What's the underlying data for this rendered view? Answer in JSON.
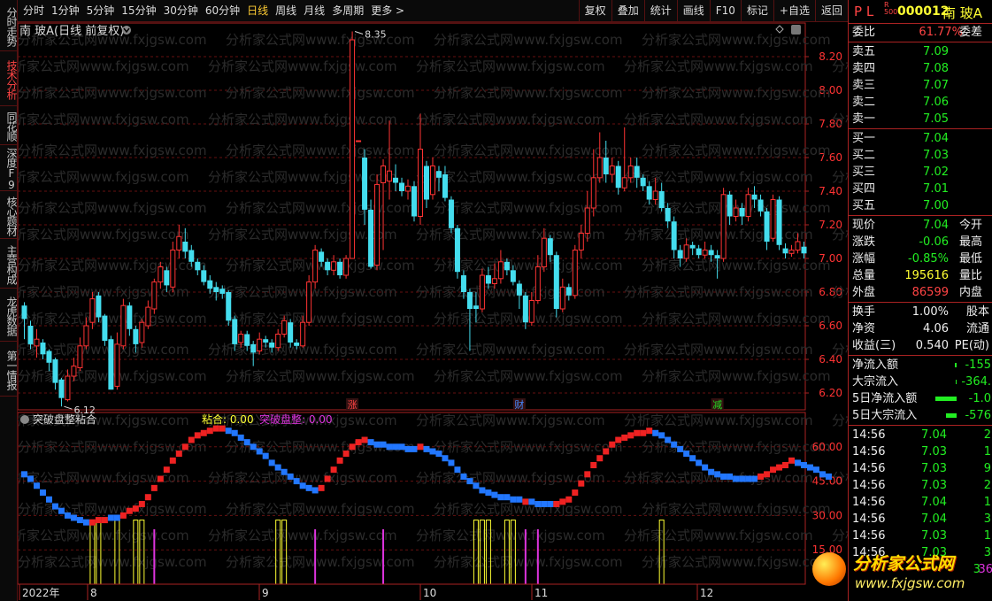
{
  "toolbar": {
    "periods": [
      "分时",
      "1分钟",
      "5分钟",
      "15分钟",
      "30分钟",
      "60分钟",
      "日线",
      "周线",
      "月线",
      "多周期",
      "更多 >"
    ],
    "active_period": "日线",
    "right_buttons": [
      "复权",
      "叠加",
      "统计",
      "画线",
      "F10",
      "标记",
      "+自选",
      "返回"
    ]
  },
  "left_nav": [
    "分时走势",
    "技术分析",
    "同花顺",
    "深度F9",
    "核心题材",
    "主营构成",
    "龙虎数据",
    "第一情报"
  ],
  "left_nav_active": 1,
  "main_chart": {
    "title": "南 玻A(日线 前复权)",
    "high_label": "8.35",
    "low_label": "6.12",
    "y_ticks": [
      "8.20",
      "8.00",
      "7.80",
      "7.60",
      "7.40",
      "7.20",
      "7.00",
      "6.80",
      "6.60",
      "6.40",
      "6.20"
    ],
    "markers": [
      "涨",
      "财",
      "减"
    ]
  },
  "indicator": {
    "name": "突破盘整粘合",
    "label1": "粘合: 0.00",
    "label2": "突破盘整: 0.00",
    "y_ticks": [
      "60.00",
      "45.00",
      "30.00",
      "15.00"
    ]
  },
  "x_axis": [
    "2022年",
    "8",
    "9",
    "10",
    "11",
    "12"
  ],
  "watermark": "分析家公式网www.fxjgsw.com",
  "logo_text": "分析家公式网",
  "logo_url": "www.fxjgsw.com",
  "colors": {
    "up": "#ff3333",
    "down": "#44ddee",
    "grid": "#661111",
    "border": "#aa2222",
    "yellow": "#ffff33",
    "magenta": "#dd33dd",
    "accent": "#ffcc33"
  },
  "chart_data": {
    "type": "candlestick",
    "series": "南玻A 日线",
    "candles": [
      [
        6.72,
        6.64,
        6.74,
        6.52
      ],
      [
        6.6,
        6.49,
        6.63,
        6.46
      ],
      [
        6.48,
        6.52,
        6.58,
        6.41
      ],
      [
        6.5,
        6.43,
        6.52,
        6.4
      ],
      [
        6.45,
        6.38,
        6.46,
        6.33
      ],
      [
        6.4,
        6.26,
        6.41,
        6.22
      ],
      [
        6.28,
        6.17,
        6.29,
        6.12
      ],
      [
        6.16,
        6.3,
        6.34,
        6.15
      ],
      [
        6.3,
        6.36,
        6.41,
        6.27
      ],
      [
        6.35,
        6.48,
        6.53,
        6.33
      ],
      [
        6.48,
        6.6,
        6.65,
        6.46
      ],
      [
        6.62,
        6.76,
        6.8,
        6.58
      ],
      [
        6.78,
        6.65,
        6.8,
        6.62
      ],
      [
        6.66,
        6.51,
        6.67,
        6.48
      ],
      [
        6.52,
        6.22,
        6.54,
        6.22
      ],
      [
        6.24,
        6.49,
        6.56,
        6.22
      ],
      [
        6.48,
        6.72,
        6.76,
        6.46
      ],
      [
        6.72,
        6.58,
        6.74,
        6.54
      ],
      [
        6.58,
        6.49,
        6.6,
        6.44
      ],
      [
        6.5,
        6.62,
        6.64,
        6.47
      ],
      [
        6.6,
        6.71,
        6.75,
        6.58
      ],
      [
        6.7,
        6.86,
        6.88,
        6.67
      ],
      [
        6.86,
        6.95,
        6.98,
        6.82
      ],
      [
        6.93,
        6.84,
        6.95,
        6.8
      ],
      [
        6.83,
        7.05,
        7.1,
        6.8
      ],
      [
        7.05,
        7.13,
        7.2,
        7.0
      ],
      [
        7.1,
        7.04,
        7.18,
        7.0
      ],
      [
        7.05,
        6.98,
        7.08,
        6.95
      ],
      [
        6.98,
        6.93,
        7.0,
        6.9
      ],
      [
        6.93,
        6.86,
        6.96,
        6.84
      ],
      [
        6.87,
        6.82,
        6.9,
        6.79
      ],
      [
        6.83,
        6.8,
        6.86,
        6.75
      ],
      [
        6.82,
        6.79,
        6.84,
        6.76
      ],
      [
        6.8,
        6.63,
        6.81,
        6.6
      ],
      [
        6.64,
        6.49,
        6.66,
        6.45
      ],
      [
        6.5,
        6.55,
        6.57,
        6.47
      ],
      [
        6.55,
        6.48,
        6.57,
        6.45
      ],
      [
        6.49,
        6.44,
        6.51,
        6.36
      ],
      [
        6.45,
        6.52,
        6.56,
        6.43
      ],
      [
        6.52,
        6.5,
        6.54,
        6.47
      ],
      [
        6.5,
        6.47,
        6.52,
        6.44
      ],
      [
        6.47,
        6.55,
        6.58,
        6.45
      ],
      [
        6.55,
        6.63,
        6.66,
        6.53
      ],
      [
        6.62,
        6.5,
        6.64,
        6.47
      ],
      [
        6.5,
        6.48,
        6.52,
        6.46
      ],
      [
        6.48,
        6.62,
        6.66,
        6.47
      ],
      [
        6.62,
        6.86,
        6.9,
        6.6
      ],
      [
        6.86,
        7.05,
        7.08,
        6.82
      ],
      [
        7.04,
        6.98,
        7.06,
        6.95
      ],
      [
        6.98,
        6.93,
        7.0,
        6.9
      ],
      [
        6.93,
        6.98,
        7.02,
        6.9
      ],
      [
        6.98,
        6.9,
        7.0,
        6.88
      ],
      [
        6.9,
        7.0,
        7.02,
        6.88
      ],
      [
        7.0,
        8.3,
        8.35,
        7.0
      ],
      [
        7.7,
        7.7,
        7.7,
        7.7
      ],
      [
        7.6,
        7.29,
        7.65,
        7.2
      ],
      [
        7.29,
        6.95,
        7.35,
        6.94
      ],
      [
        6.96,
        7.44,
        7.5,
        6.93
      ],
      [
        7.45,
        7.55,
        7.59,
        7.05
      ],
      [
        7.46,
        7.52,
        7.82,
        7.35
      ],
      [
        7.48,
        7.45,
        7.56,
        7.4
      ],
      [
        7.45,
        7.4,
        7.48,
        7.37
      ],
      [
        7.4,
        7.43,
        7.47,
        7.35
      ],
      [
        7.43,
        7.25,
        7.46,
        7.22
      ],
      [
        7.25,
        7.65,
        7.86,
        7.2
      ],
      [
        7.55,
        7.35,
        7.58,
        7.3
      ],
      [
        7.38,
        7.55,
        7.6,
        7.35
      ],
      [
        7.52,
        7.48,
        7.55,
        7.4
      ],
      [
        7.5,
        7.36,
        7.55,
        7.34
      ],
      [
        7.35,
        7.18,
        7.37,
        7.15
      ],
      [
        7.18,
        6.92,
        7.2,
        6.88
      ],
      [
        6.9,
        6.8,
        6.93,
        6.76
      ],
      [
        6.8,
        6.7,
        6.82,
        6.45
      ],
      [
        6.72,
        6.7,
        6.8,
        6.62
      ],
      [
        6.7,
        6.9,
        6.94,
        6.68
      ],
      [
        6.9,
        6.85,
        6.95,
        6.82
      ],
      [
        6.85,
        6.88,
        6.97,
        6.82
      ],
      [
        6.88,
        6.98,
        7.05,
        6.85
      ],
      [
        6.98,
        6.93,
        7.0,
        6.9
      ],
      [
        6.93,
        6.86,
        6.96,
        6.84
      ],
      [
        6.85,
        6.78,
        6.87,
        6.7
      ],
      [
        6.78,
        6.62,
        6.8,
        6.58
      ],
      [
        6.62,
        6.75,
        6.8,
        6.6
      ],
      [
        6.75,
        6.95,
        7.02,
        6.73
      ],
      [
        6.95,
        7.12,
        7.18,
        6.92
      ],
      [
        7.12,
        7.02,
        7.14,
        6.98
      ],
      [
        7.02,
        6.7,
        7.04,
        6.65
      ],
      [
        6.7,
        6.83,
        6.88,
        6.68
      ],
      [
        6.83,
        6.78,
        6.85,
        6.75
      ],
      [
        6.78,
        7.05,
        7.08,
        6.76
      ],
      [
        7.05,
        7.15,
        7.2,
        7.0
      ],
      [
        7.15,
        7.3,
        7.4,
        7.1
      ],
      [
        7.3,
        7.48,
        7.65,
        7.25
      ],
      [
        7.48,
        7.6,
        7.75,
        7.45
      ],
      [
        7.6,
        7.5,
        7.7,
        7.45
      ],
      [
        7.5,
        7.55,
        7.6,
        7.45
      ],
      [
        7.55,
        7.42,
        7.58,
        7.38
      ],
      [
        7.42,
        7.48,
        7.78,
        7.4
      ],
      [
        7.48,
        7.55,
        7.6,
        7.45
      ],
      [
        7.55,
        7.48,
        7.6,
        7.42
      ],
      [
        7.48,
        7.43,
        7.5,
        7.4
      ],
      [
        7.43,
        7.35,
        7.46,
        7.32
      ],
      [
        7.35,
        7.4,
        7.48,
        7.32
      ],
      [
        7.4,
        7.3,
        7.45,
        7.28
      ],
      [
        7.3,
        7.22,
        7.33,
        7.18
      ],
      [
        7.22,
        7.05,
        7.25,
        7.0
      ],
      [
        7.05,
        7.0,
        7.08,
        6.95
      ],
      [
        7.0,
        7.08,
        7.12,
        6.98
      ],
      [
        7.08,
        7.06,
        7.1,
        7.02
      ],
      [
        7.06,
        7.02,
        7.08,
        7.0
      ],
      [
        7.02,
        7.05,
        7.1,
        7.0
      ],
      [
        7.05,
        7.02,
        7.08,
        6.98
      ],
      [
        7.02,
        7.0,
        7.05,
        6.88
      ],
      [
        7.0,
        7.38,
        7.42,
        6.98
      ],
      [
        7.38,
        7.25,
        7.4,
        7.2
      ],
      [
        7.25,
        7.3,
        7.35,
        7.22
      ],
      [
        7.3,
        7.25,
        7.33,
        7.2
      ],
      [
        7.25,
        7.38,
        7.42,
        7.22
      ],
      [
        7.38,
        7.35,
        7.43,
        7.3
      ],
      [
        7.35,
        7.28,
        7.38,
        7.25
      ],
      [
        7.28,
        7.1,
        7.3,
        7.05
      ],
      [
        7.12,
        7.35,
        7.38,
        7.1
      ],
      [
        7.35,
        7.08,
        7.37,
        7.05
      ],
      [
        7.06,
        7.03,
        7.09,
        7.0
      ],
      [
        7.03,
        7.05,
        7.08,
        7.01
      ],
      [
        7.05,
        7.1,
        7.15,
        7.03
      ],
      [
        7.07,
        7.03,
        7.1,
        7.0
      ]
    ],
    "y_range": [
      6.1,
      8.4
    ]
  },
  "indicator_data": {
    "type": "bar",
    "dots": [
      [
        48,
        0
      ],
      [
        46,
        0
      ],
      [
        43,
        0
      ],
      [
        40,
        0
      ],
      [
        37,
        0
      ],
      [
        34,
        0
      ],
      [
        32,
        0
      ],
      [
        30,
        0
      ],
      [
        29,
        0
      ],
      [
        28,
        0
      ],
      [
        27,
        0
      ],
      [
        27,
        1
      ],
      [
        28,
        1
      ],
      [
        28,
        1
      ],
      [
        29,
        0
      ],
      [
        29,
        0
      ],
      [
        30,
        1
      ],
      [
        32,
        1
      ],
      [
        33,
        1
      ],
      [
        35,
        1
      ],
      [
        38,
        1
      ],
      [
        42,
        1
      ],
      [
        46,
        1
      ],
      [
        50,
        1
      ],
      [
        54,
        1
      ],
      [
        57,
        1
      ],
      [
        60,
        1
      ],
      [
        63,
        1
      ],
      [
        65,
        1
      ],
      [
        66,
        1
      ],
      [
        67,
        1
      ],
      [
        68,
        1
      ],
      [
        68,
        1
      ],
      [
        67,
        0
      ],
      [
        66,
        0
      ],
      [
        64,
        0
      ],
      [
        62,
        0
      ],
      [
        60,
        0
      ],
      [
        58,
        0
      ],
      [
        56,
        0
      ],
      [
        53,
        0
      ],
      [
        51,
        0
      ],
      [
        49,
        0
      ],
      [
        47,
        0
      ],
      [
        45,
        0
      ],
      [
        43,
        0
      ],
      [
        42,
        0
      ],
      [
        41,
        0
      ],
      [
        42,
        1
      ],
      [
        46,
        1
      ],
      [
        50,
        1
      ],
      [
        54,
        1
      ],
      [
        57,
        1
      ],
      [
        60,
        1
      ],
      [
        62,
        1
      ],
      [
        63,
        1
      ],
      [
        62,
        0
      ],
      [
        61,
        0
      ],
      [
        61,
        0
      ],
      [
        60,
        0
      ],
      [
        60,
        0
      ],
      [
        60,
        0
      ],
      [
        59,
        0
      ],
      [
        59,
        0
      ],
      [
        60,
        1
      ],
      [
        59,
        0
      ],
      [
        58,
        0
      ],
      [
        57,
        0
      ],
      [
        55,
        0
      ],
      [
        53,
        0
      ],
      [
        50,
        0
      ],
      [
        47,
        0
      ],
      [
        45,
        0
      ],
      [
        43,
        0
      ],
      [
        41,
        0
      ],
      [
        40,
        0
      ],
      [
        39,
        0
      ],
      [
        38,
        0
      ],
      [
        38,
        0
      ],
      [
        37,
        0
      ],
      [
        37,
        0
      ],
      [
        36,
        1
      ],
      [
        36,
        0
      ],
      [
        35,
        0
      ],
      [
        35,
        0
      ],
      [
        35,
        0
      ],
      [
        35,
        1
      ],
      [
        36,
        1
      ],
      [
        37,
        1
      ],
      [
        40,
        1
      ],
      [
        44,
        1
      ],
      [
        48,
        1
      ],
      [
        52,
        1
      ],
      [
        55,
        1
      ],
      [
        58,
        1
      ],
      [
        61,
        1
      ],
      [
        63,
        1
      ],
      [
        64,
        1
      ],
      [
        65,
        1
      ],
      [
        66,
        1
      ],
      [
        66,
        1
      ],
      [
        67,
        1
      ],
      [
        66,
        0
      ],
      [
        65,
        0
      ],
      [
        63,
        0
      ],
      [
        61,
        0
      ],
      [
        59,
        0
      ],
      [
        57,
        0
      ],
      [
        55,
        0
      ],
      [
        53,
        0
      ],
      [
        51,
        0
      ],
      [
        49,
        0
      ],
      [
        48,
        0
      ],
      [
        47,
        0
      ],
      [
        47,
        0
      ],
      [
        46,
        0
      ],
      [
        46,
        0
      ],
      [
        46,
        0
      ],
      [
        46,
        0
      ],
      [
        47,
        1
      ],
      [
        48,
        1
      ],
      [
        50,
        1
      ],
      [
        51,
        1
      ],
      [
        52,
        1
      ],
      [
        54,
        1
      ],
      [
        53,
        0
      ],
      [
        52,
        0
      ],
      [
        51,
        0
      ],
      [
        50,
        0
      ],
      [
        48,
        0
      ],
      [
        47,
        0
      ]
    ],
    "yellow_bars": [
      11,
      12,
      15,
      18,
      19,
      41,
      42,
      73,
      74,
      75,
      78,
      79,
      103
    ],
    "magenta_bars": [
      21,
      47,
      58,
      81,
      83
    ],
    "y_range": [
      0,
      75
    ]
  },
  "quote": {
    "header": {
      "pl": "P L",
      "r_sub": "R\n500",
      "code": "000012",
      "name": "南 玻A"
    },
    "weibi": {
      "label": "委比",
      "value": "61.77%",
      "label2": "委差"
    },
    "asks": [
      {
        "label": "卖五",
        "price": "7.09"
      },
      {
        "label": "卖四",
        "price": "7.08"
      },
      {
        "label": "卖三",
        "price": "7.07"
      },
      {
        "label": "卖二",
        "price": "7.06"
      },
      {
        "label": "卖一",
        "price": "7.05"
      }
    ],
    "bids": [
      {
        "label": "买一",
        "price": "7.04"
      },
      {
        "label": "买二",
        "price": "7.03"
      },
      {
        "label": "买三",
        "price": "7.02"
      },
      {
        "label": "买四",
        "price": "7.01"
      },
      {
        "label": "买五",
        "price": "7.00"
      }
    ],
    "stats": [
      {
        "label": "现价",
        "value": "7.04",
        "label2": "今开",
        "color": "green"
      },
      {
        "label": "涨跌",
        "value": "-0.06",
        "label2": "最高",
        "color": "green"
      },
      {
        "label": "涨幅",
        "value": "-0.85%",
        "label2": "最低",
        "color": "green"
      },
      {
        "label": "总量",
        "value": "195616",
        "label2": "量比",
        "color": "yellow"
      },
      {
        "label": "外盘",
        "value": "86599",
        "label2": "内盘",
        "color": "red"
      }
    ],
    "stats2": [
      {
        "label": "换手",
        "value": "1.00%",
        "label2": "股本"
      },
      {
        "label": "净资",
        "value": "4.06",
        "label2": "流通"
      },
      {
        "label": "收益(三)",
        "value": "0.540",
        "label2": "PE(动)"
      }
    ],
    "flows": [
      {
        "label": "净流入额",
        "value": "-155",
        "bar": 2
      },
      {
        "label": "大宗流入",
        "value": "-364.",
        "bar": 1
      },
      {
        "label": "5日净流入额",
        "value": "-1.0",
        "bar": 24
      },
      {
        "label": "5日大宗流入",
        "value": "-576",
        "bar": 12
      }
    ],
    "ticks": [
      {
        "time": "14:56",
        "price": "7.04",
        "vol": "2"
      },
      {
        "time": "14:56",
        "price": "7.03",
        "vol": "1"
      },
      {
        "time": "14:56",
        "price": "7.03",
        "vol": "9"
      },
      {
        "time": "14:56",
        "price": "7.03",
        "vol": "2"
      },
      {
        "time": "14:56",
        "price": "7.04",
        "vol": "1"
      },
      {
        "time": "14:56",
        "price": "7.04",
        "vol": "3"
      },
      {
        "time": "14:56",
        "price": "7.03",
        "vol": "1"
      },
      {
        "time": "14:56",
        "price": "7.03",
        "vol": "3"
      }
    ],
    "bottom_partial": [
      "3",
      "36"
    ]
  }
}
